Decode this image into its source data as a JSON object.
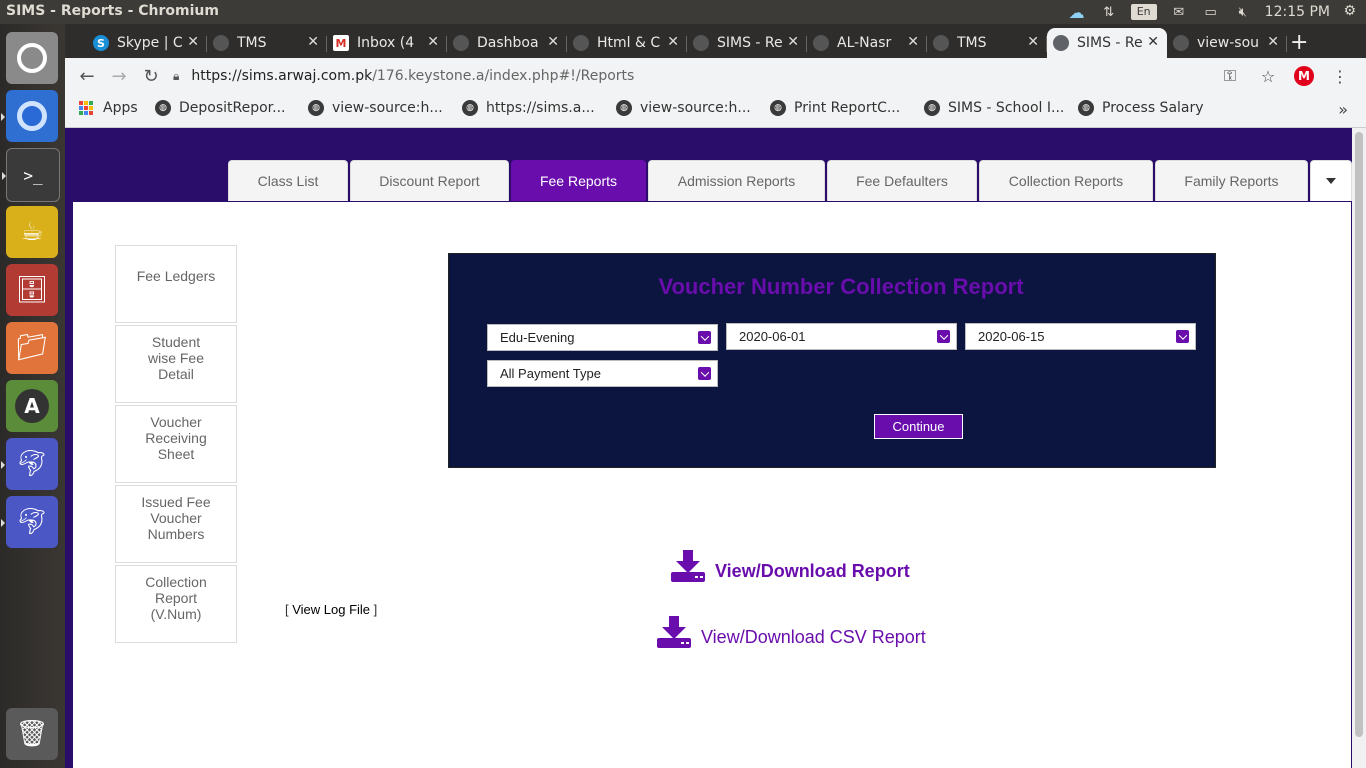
{
  "system": {
    "window_title": "SIMS - Reports - Chromium",
    "lang": "En",
    "clock": "12:15 PM"
  },
  "browser": {
    "tabs": [
      {
        "label": "Skype | C",
        "icon": "skype-icon"
      },
      {
        "label": "TMS",
        "icon": "globe-icon"
      },
      {
        "label": "Inbox (4",
        "icon": "gmail-icon"
      },
      {
        "label": "Dashboa",
        "icon": "globe-icon"
      },
      {
        "label": "Html & C",
        "icon": "globe-icon"
      },
      {
        "label": "SIMS - Re",
        "icon": "globe-icon"
      },
      {
        "label": "AL-Nasr",
        "icon": "globe-icon"
      },
      {
        "label": "TMS",
        "icon": "globe-icon"
      },
      {
        "label": "SIMS - Re",
        "icon": "globe-icon",
        "active": true
      },
      {
        "label": "view-sou",
        "icon": "globe-icon"
      }
    ],
    "url_host": "https://sims.arwaj.com.pk",
    "url_path": "/176.keystone.a/index.php#!/Reports",
    "profile_initial": "M",
    "bookmarks": [
      {
        "label": "Apps"
      },
      {
        "label": "DepositRepor..."
      },
      {
        "label": "view-source:h..."
      },
      {
        "label": "https://sims.a..."
      },
      {
        "label": "view-source:h..."
      },
      {
        "label": "Print ReportC..."
      },
      {
        "label": "SIMS - School I..."
      },
      {
        "label": "Process Salary"
      }
    ],
    "more": "»"
  },
  "report_tabs": [
    {
      "label": "Class List"
    },
    {
      "label": "Discount Report"
    },
    {
      "label": "Fee Reports",
      "active": true
    },
    {
      "label": "Admission Reports"
    },
    {
      "label": "Fee Defaulters"
    },
    {
      "label": "Collection Reports"
    },
    {
      "label": "Family Reports"
    }
  ],
  "side_nav": [
    {
      "label": "Fee Ledgers"
    },
    {
      "label": "Student wise Fee Detail"
    },
    {
      "label": "Voucher Receiving Sheet"
    },
    {
      "label": "Issued Fee Voucher Numbers"
    },
    {
      "label": "Collection Report (V.Num)"
    }
  ],
  "log_file": {
    "open": "[ ",
    "link": "View Log File",
    "close": " ]"
  },
  "filter": {
    "title": "Voucher Number Collection Report",
    "campus": "Edu-Evening",
    "date_from": "2020-06-01",
    "date_to": "2020-06-15",
    "payment_type": "All Payment Type",
    "continue_label": "Continue"
  },
  "downloads": {
    "report_label": "View/Download Report",
    "csv_label": "View/Download CSV Report"
  },
  "colors": {
    "accent": "#6a0dad",
    "panel_bg": "#0c1440",
    "page_bg": "#2a0c6b"
  }
}
